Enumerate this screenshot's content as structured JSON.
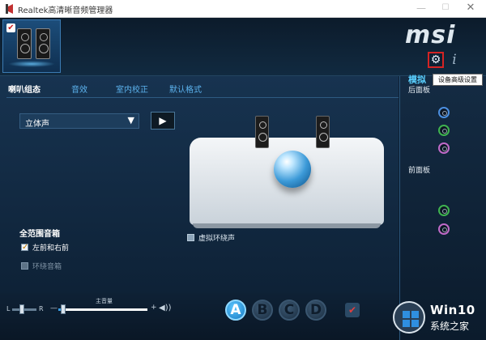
{
  "window": {
    "title": "Realtek高清晰音频管理器",
    "min_glyph": "—",
    "max_glyph": "☐",
    "close_glyph": "✕"
  },
  "device": {
    "check_glyph": "✔"
  },
  "brand": {
    "logo": "msi"
  },
  "toolbar": {
    "gear_glyph": "⚙",
    "info_glyph": "i",
    "tooltip": "设备高级设置"
  },
  "tabs": [
    {
      "label": "喇叭组态",
      "active": true
    },
    {
      "label": "音效"
    },
    {
      "label": "室内校正"
    },
    {
      "label": "默认格式"
    }
  ],
  "config": {
    "selected": "立体声",
    "arrow_glyph": "▼",
    "play_glyph": "▶"
  },
  "virtual_surround": {
    "label": "虚拟环绕声",
    "checked": false
  },
  "full_range": {
    "title": "全范围音箱",
    "options": [
      {
        "label": "左前和右前",
        "checked": true,
        "enabled": true
      },
      {
        "label": "环绕音箱",
        "checked": false,
        "enabled": false
      }
    ]
  },
  "volume": {
    "balance_left": "L",
    "balance_right": "R",
    "label": "主音量",
    "minus": "—",
    "plus": "+",
    "speaker_glyph": "◀))",
    "level": 0.05
  },
  "profiles": [
    "A",
    "B",
    "C",
    "D"
  ],
  "bottom_icons": {
    "confirm_glyph": "✔"
  },
  "analog": {
    "title": "模拟",
    "back_panel": "后面板",
    "front_panel": "前面板"
  },
  "watermark": {
    "brand": "Win10",
    "site": "系统之家"
  },
  "colors": {
    "accent": "#5cb3ee",
    "highlight": "#d42424"
  }
}
